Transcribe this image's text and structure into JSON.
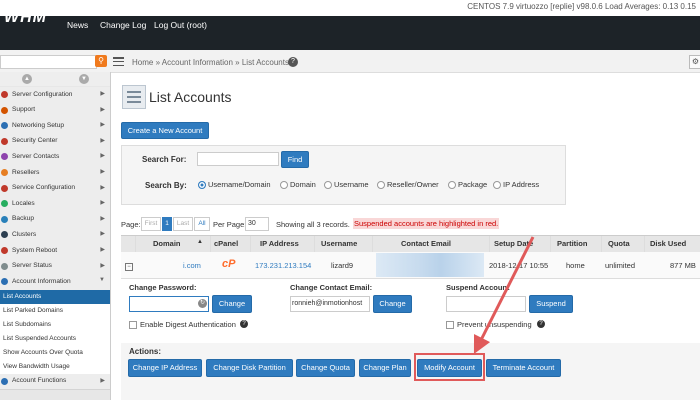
{
  "topbar": {
    "sysinfo": "CENTOS 7.9 virtuozzo [replie]   v98.0.6   Load Averages: 0.13 0.15"
  },
  "nav": {
    "logo": "WHM",
    "links": [
      "News",
      "Change Log",
      "Log Out (root)"
    ]
  },
  "breadcrumb": {
    "text": "Home » Account Information » List Accounts",
    "help": "?"
  },
  "sidebar": {
    "items": [
      {
        "label": "Server Configuration",
        "color": "#c0392b"
      },
      {
        "label": "Support",
        "color": "#d35400"
      },
      {
        "label": "Networking Setup",
        "color": "#2c6fb3"
      },
      {
        "label": "Security Center",
        "color": "#c0392b"
      },
      {
        "label": "Server Contacts",
        "color": "#8e44ad"
      },
      {
        "label": "Resellers",
        "color": "#e67e22"
      },
      {
        "label": "Service Configuration",
        "color": "#c0392b"
      },
      {
        "label": "Locales",
        "color": "#27ae60"
      },
      {
        "label": "Backup",
        "color": "#2980b9"
      },
      {
        "label": "Clusters",
        "color": "#2c3e50"
      },
      {
        "label": "System Reboot",
        "color": "#c0392b"
      },
      {
        "label": "Server Status",
        "color": "#7f8c8d"
      },
      {
        "label": "Account Information",
        "color": "#2c6fb3"
      }
    ],
    "subitems": [
      "List Accounts",
      "List Parked Domains",
      "List Subdomains",
      "List Suspended Accounts",
      "Show Accounts Over Quota",
      "View Bandwidth Usage"
    ],
    "after": {
      "label": "Account Functions",
      "color": "#2c6fb3"
    }
  },
  "page": {
    "title": "List Accounts",
    "create_button": "Create a New Account"
  },
  "search": {
    "for_label": "Search For:",
    "find_button": "Find",
    "by_label": "Search By:",
    "options": [
      "Username/Domain",
      "Domain",
      "Username",
      "Reseller/Owner",
      "Package",
      "IP Address"
    ],
    "selected": "Username/Domain"
  },
  "pagination": {
    "page_label": "Page:",
    "first": "First",
    "current": "1",
    "last": "Last",
    "all": "All",
    "per_page_label": "Per Page:",
    "per_page_value": "30",
    "records_text": "Showing all 3 records.",
    "suspended_note": "Suspended accounts are highlighted in red."
  },
  "table": {
    "headers": [
      "Domain",
      "cPanel",
      "IP Address",
      "Username",
      "Contact Email",
      "Setup Date",
      "Partition",
      "Quota",
      "Disk Used"
    ],
    "sort_indicator": "▲",
    "row": {
      "expand": "⊟",
      "domain": "i.com",
      "cpanel_logo": "cP",
      "ip": "173.231.213.154",
      "username": "lizard9",
      "setup_date": "2018-12-17 10:55",
      "partition": "home",
      "quota": "unlimited",
      "disk_used": "877 MB"
    }
  },
  "edit": {
    "password_label": "Change Password:",
    "password_button": "Change",
    "digest_label": "Enable Digest Authentication",
    "email_label": "Change Contact Email:",
    "email_value": "ronnieh@inmotionhost",
    "email_button": "Change",
    "suspend_label": "Suspend Account",
    "suspend_button": "Suspend",
    "prevent_label": "Prevent unsuspending"
  },
  "actions": {
    "label": "Actions:",
    "buttons": [
      "Change IP Address",
      "Change Disk Partition",
      "Change Quota",
      "Change Plan",
      "Modify Account",
      "Terminate Account"
    ],
    "highlighted": "Modify Account"
  },
  "colors": {
    "primary": "#2f7bbf",
    "nav_bg": "#1d2328",
    "highlight": "#e05a5a",
    "search_orange": "#f07a1d"
  }
}
